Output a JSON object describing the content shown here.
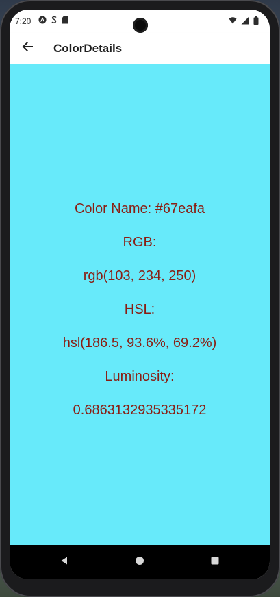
{
  "status_bar": {
    "time": "7:20"
  },
  "app_bar": {
    "title": "ColorDetails"
  },
  "details": {
    "color_name_label": "Color Name: #67eafa",
    "rgb_label": "RGB:",
    "rgb_value": "rgb(103, 234, 250)",
    "hsl_label": "HSL:",
    "hsl_value": "hsl(186.5, 93.6%, 69.2%)",
    "luminosity_label": "Luminosity:",
    "luminosity_value": "0.6863132935335172"
  },
  "colors": {
    "background": "#67eafa",
    "text": "#8a1e13"
  },
  "icons": {
    "back": "arrow-back-icon",
    "status_left": [
      "a-app-icon",
      "s-app-icon",
      "sd-card-icon"
    ],
    "status_right": [
      "wifi-icon",
      "signal-icon",
      "battery-icon"
    ],
    "nav": [
      "back-triangle-icon",
      "home-circle-icon",
      "recents-square-icon"
    ]
  }
}
